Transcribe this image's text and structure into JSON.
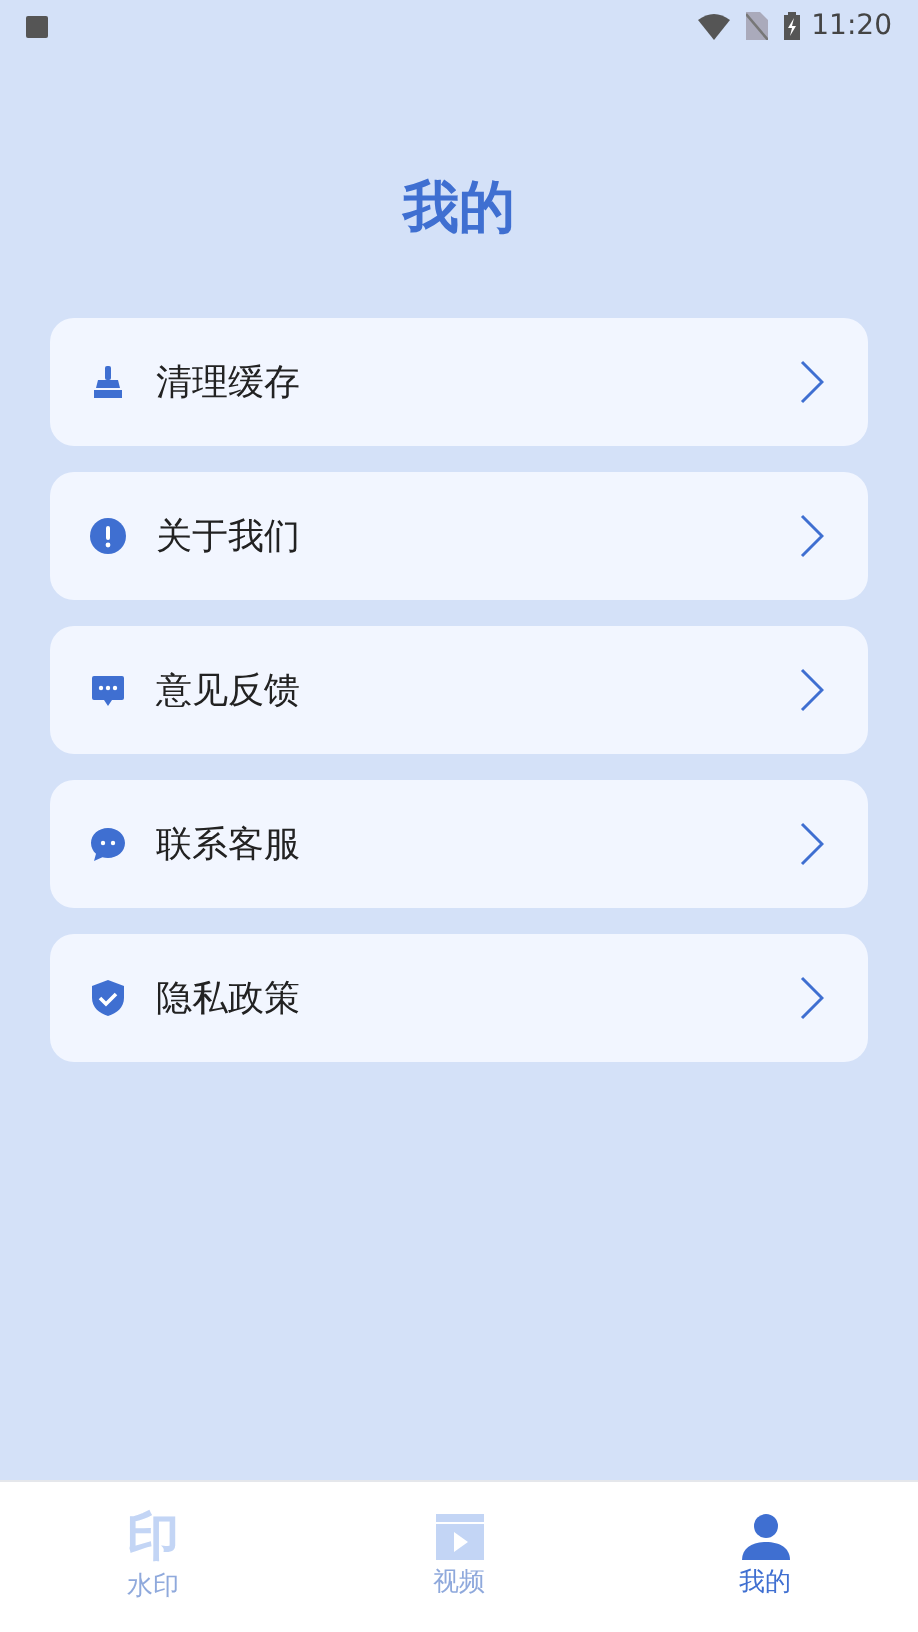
{
  "status_bar": {
    "time": "11:20"
  },
  "title": "我的",
  "menu": [
    {
      "kind": "broom",
      "label": "清理缓存"
    },
    {
      "kind": "info",
      "label": "关于我们"
    },
    {
      "kind": "feedback",
      "label": "意见反馈"
    },
    {
      "kind": "chat",
      "label": "联系客服"
    },
    {
      "kind": "shield",
      "label": "隐私政策"
    }
  ],
  "tabs": [
    {
      "kind": "stamp",
      "glyph": "印",
      "label": "水印",
      "selected": false
    },
    {
      "kind": "video",
      "label": "视频",
      "selected": false
    },
    {
      "kind": "person",
      "label": "我的",
      "selected": true
    }
  ]
}
